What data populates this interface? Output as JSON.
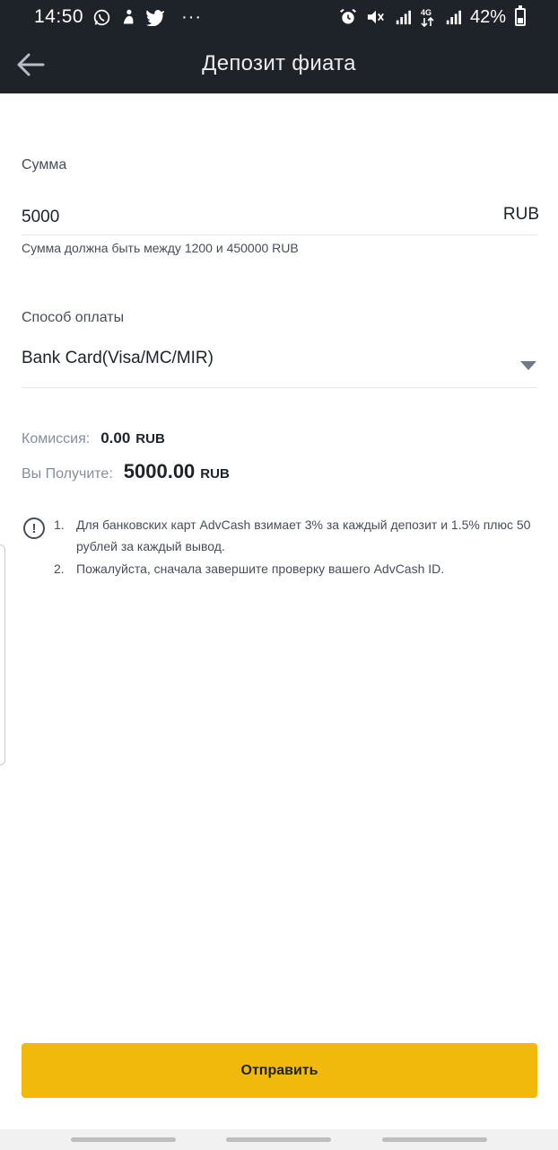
{
  "status_bar": {
    "time": "14:50",
    "battery": "42%",
    "more": "···",
    "left_icons": [
      "whatsapp-icon",
      "notification-icon",
      "twitter-icon"
    ],
    "right_icons": [
      "alarm-icon",
      "mute-icon",
      "signal-icon",
      "network-4g-icon",
      "signal-icon"
    ]
  },
  "app_bar": {
    "title": "Депозит фиата",
    "back_icon": "arrow-left-icon"
  },
  "amount": {
    "label": "Сумма",
    "value": "5000",
    "currency": "RUB",
    "hint": "Сумма должна быть между 1200 и 450000 RUB"
  },
  "payment_method": {
    "label": "Способ оплаты",
    "selected": "Bank Card(Visa/MC/MIR)",
    "icon": "caret-down-icon"
  },
  "fee": {
    "label": "Комиссия:",
    "value": "0.00",
    "unit": "RUB"
  },
  "receive": {
    "label": "Вы Получите:",
    "value": "5000.00",
    "unit": "RUB"
  },
  "notice": {
    "icon": "exclamation-circle-icon",
    "icon_glyph": "!",
    "items": [
      {
        "num": "1.",
        "text": "Для банковских карт AdvCash взимает 3% за каждый депозит и 1.5% плюс 50 рублей за каждый вывод."
      },
      {
        "num": "2.",
        "text": "Пожалуйста, сначала завершите проверку вашего AdvCash ID."
      }
    ]
  },
  "submit": {
    "label": "Отправить"
  },
  "colors": {
    "header_bg": "#1e2329",
    "accent": "#f0b90b",
    "text_primary": "#1e2329",
    "text_secondary": "#474d57",
    "text_muted": "#848e9c"
  }
}
